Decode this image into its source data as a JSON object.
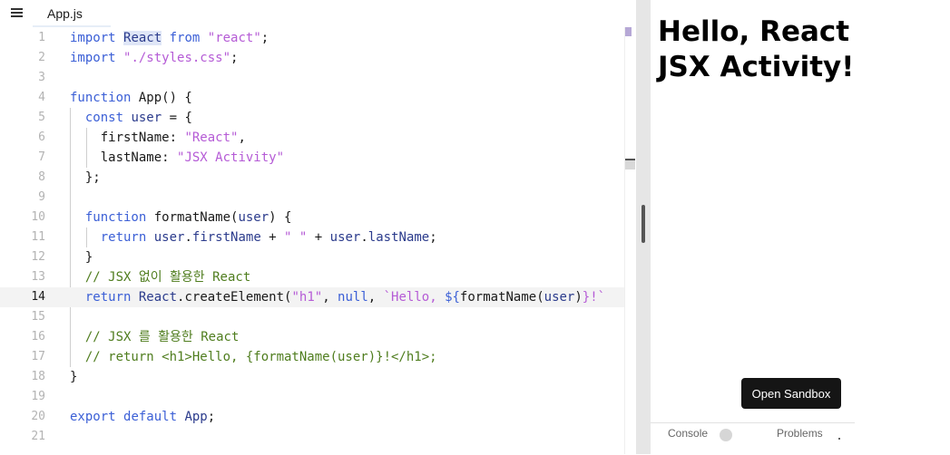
{
  "editor": {
    "tab_label": "App.js",
    "active_line": 14,
    "lines": [
      {
        "n": "1",
        "tokens": [
          {
            "t": "import ",
            "c": "kw"
          },
          {
            "t": "React",
            "c": "id hl"
          },
          {
            "t": " ",
            "c": ""
          },
          {
            "t": "from",
            "c": "kw"
          },
          {
            "t": " ",
            "c": ""
          },
          {
            "t": "\"react\"",
            "c": "str"
          },
          {
            "t": ";",
            "c": ""
          }
        ]
      },
      {
        "n": "2",
        "tokens": [
          {
            "t": "import ",
            "c": "kw"
          },
          {
            "t": "\"./styles.css\"",
            "c": "str"
          },
          {
            "t": ";",
            "c": ""
          }
        ]
      },
      {
        "n": "3",
        "tokens": []
      },
      {
        "n": "4",
        "tokens": [
          {
            "t": "function ",
            "c": "kw"
          },
          {
            "t": "App() {",
            "c": ""
          }
        ]
      },
      {
        "n": "5",
        "tokens": [
          {
            "t": "  ",
            "c": ""
          },
          {
            "t": "const ",
            "c": "kw"
          },
          {
            "t": "user",
            "c": "id"
          },
          {
            "t": " = {",
            "c": ""
          }
        ]
      },
      {
        "n": "6",
        "tokens": [
          {
            "t": "    firstName: ",
            "c": ""
          },
          {
            "t": "\"React\"",
            "c": "str"
          },
          {
            "t": ",",
            "c": ""
          }
        ]
      },
      {
        "n": "7",
        "tokens": [
          {
            "t": "    lastName: ",
            "c": ""
          },
          {
            "t": "\"JSX Activity\"",
            "c": "str"
          }
        ]
      },
      {
        "n": "8",
        "tokens": [
          {
            "t": "  };",
            "c": ""
          }
        ]
      },
      {
        "n": "9",
        "tokens": []
      },
      {
        "n": "10",
        "tokens": [
          {
            "t": "  ",
            "c": ""
          },
          {
            "t": "function ",
            "c": "kw"
          },
          {
            "t": "formatName(",
            "c": ""
          },
          {
            "t": "user",
            "c": "id"
          },
          {
            "t": ") {",
            "c": ""
          }
        ]
      },
      {
        "n": "11",
        "tokens": [
          {
            "t": "    ",
            "c": ""
          },
          {
            "t": "return ",
            "c": "kw"
          },
          {
            "t": "user",
            "c": "id"
          },
          {
            "t": ".",
            "c": ""
          },
          {
            "t": "firstName",
            "c": "id"
          },
          {
            "t": " + ",
            "c": ""
          },
          {
            "t": "\" \"",
            "c": "str"
          },
          {
            "t": " + ",
            "c": ""
          },
          {
            "t": "user",
            "c": "id"
          },
          {
            "t": ".",
            "c": ""
          },
          {
            "t": "lastName",
            "c": "id"
          },
          {
            "t": ";",
            "c": ""
          }
        ]
      },
      {
        "n": "12",
        "tokens": [
          {
            "t": "  }",
            "c": ""
          }
        ]
      },
      {
        "n": "13",
        "tokens": [
          {
            "t": "  ",
            "c": ""
          },
          {
            "t": "// JSX 없이 활용한 React",
            "c": "cm"
          }
        ]
      },
      {
        "n": "14",
        "tokens": [
          {
            "t": "  ",
            "c": ""
          },
          {
            "t": "return ",
            "c": "kw"
          },
          {
            "t": "React",
            "c": "id"
          },
          {
            "t": ".createElement(",
            "c": ""
          },
          {
            "t": "\"h1\"",
            "c": "str"
          },
          {
            "t": ", ",
            "c": ""
          },
          {
            "t": "null",
            "c": "kw"
          },
          {
            "t": ", ",
            "c": ""
          },
          {
            "t": "`Hello, ",
            "c": "str"
          },
          {
            "t": "${",
            "c": "kw"
          },
          {
            "t": "formatName(",
            "c": ""
          },
          {
            "t": "user",
            "c": "id"
          },
          {
            "t": ")",
            "c": ""
          },
          {
            "t": "}!`",
            "c": "str"
          }
        ]
      },
      {
        "n": "15",
        "tokens": []
      },
      {
        "n": "16",
        "tokens": [
          {
            "t": "  ",
            "c": ""
          },
          {
            "t": "// JSX 를 활용한 React",
            "c": "cm"
          }
        ]
      },
      {
        "n": "17",
        "tokens": [
          {
            "t": "  ",
            "c": ""
          },
          {
            "t": "// return <h1>Hello, {formatName(user)}!</h1>;",
            "c": "cm"
          }
        ]
      },
      {
        "n": "18",
        "tokens": [
          {
            "t": "}",
            "c": ""
          }
        ]
      },
      {
        "n": "19",
        "tokens": []
      },
      {
        "n": "20",
        "tokens": [
          {
            "t": "export ",
            "c": "kw"
          },
          {
            "t": "default ",
            "c": "kw"
          },
          {
            "t": "App",
            "c": "id"
          },
          {
            "t": ";",
            "c": ""
          }
        ]
      },
      {
        "n": "21",
        "tokens": []
      }
    ]
  },
  "preview": {
    "heading_line1": "Hello, React",
    "heading_line2": "JSX Activity!",
    "open_sandbox_label": "Open Sandbox"
  },
  "bottom_panel": {
    "console_label": "Console",
    "problems_label": "Problems"
  }
}
